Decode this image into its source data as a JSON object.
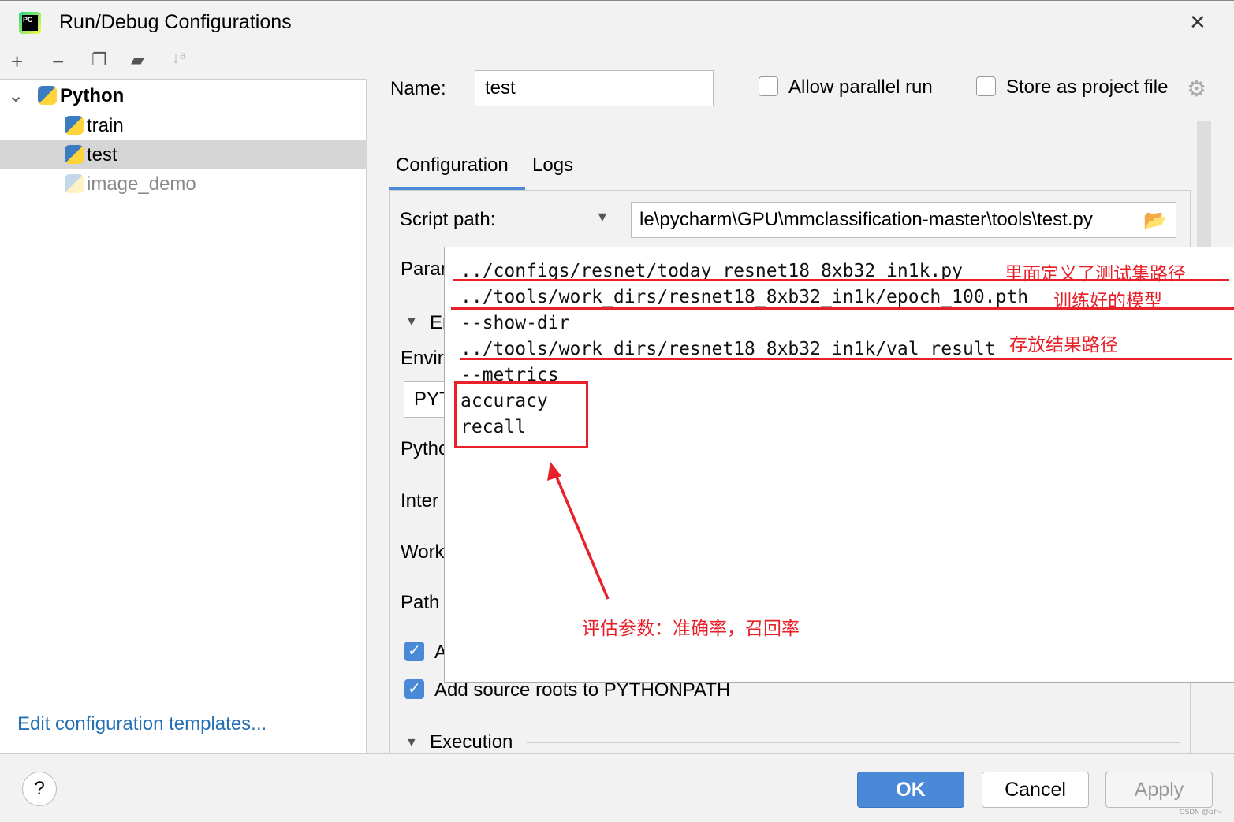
{
  "window": {
    "title": "Run/Debug Configurations",
    "logo_text": "PC"
  },
  "toolbar": {
    "icons": [
      "plus-icon",
      "minus-icon",
      "copy-icon",
      "new-folder-icon",
      "sort-alpha-icon"
    ]
  },
  "tree": {
    "root": "Python",
    "items": [
      {
        "label": "train"
      },
      {
        "label": "test",
        "selected": true
      },
      {
        "label": "image_demo",
        "disabled": true
      }
    ]
  },
  "edit_templates": "Edit configuration templates...",
  "form": {
    "name_label": "Name:",
    "name_value": "test",
    "allow_parallel": "Allow parallel run",
    "store_project": "Store as project file",
    "tabs": [
      "Configuration",
      "Logs"
    ],
    "script_path_label": "Script path:",
    "script_path_value": "le\\pycharm\\GPU\\mmclassification-master\\tools\\test.py",
    "partial_labels": [
      "Parar",
      "En",
      "Envir",
      "PYT",
      "Pytho",
      "Inter",
      "Work",
      "Path",
      "A"
    ],
    "add_source_roots": "Add source roots to PYTHONPATH",
    "execution": "Execution"
  },
  "popup": {
    "lines": [
      "../configs/resnet/today_resnet18_8xb32_in1k.py",
      "../tools/work_dirs/resnet18_8xb32_in1k/epoch_100.pth",
      "--show-dir",
      "../tools/work_dirs/resnet18_8xb32_in1k/val_result",
      "--metrics",
      "accuracy",
      "recall"
    ],
    "annotations": [
      "里面定义了测试集路径",
      "训练好的模型",
      "存放结果路径",
      "评估参数：准确率，召回率"
    ],
    "annotation_color": "#e8202a"
  },
  "buttons": {
    "help": "?",
    "ok": "OK",
    "cancel": "Cancel",
    "apply": "Apply"
  },
  "watermark": "CSDN @lzh~"
}
